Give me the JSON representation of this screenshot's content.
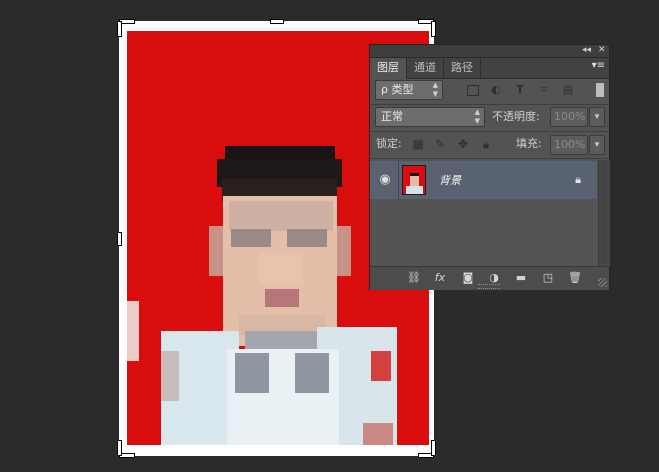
{
  "panel": {
    "tabs": [
      {
        "label": "图层",
        "active": true
      },
      {
        "label": "通道",
        "active": false
      },
      {
        "label": "路径",
        "active": false
      }
    ],
    "collapse_glyph": "◂◂",
    "close_glyph": "✕",
    "menu_glyph": "▾≡",
    "filter": {
      "kind_label": "ρ 类型",
      "icons": [
        "image-filter-icon",
        "adjustment-filter-icon",
        "type-filter-icon",
        "shape-filter-icon",
        "smart-object-filter-icon"
      ]
    },
    "blend_mode": "正常",
    "opacity_label": "不透明度:",
    "opacity_value": "100%",
    "lock_label": "锁定:",
    "fill_label": "填充:",
    "fill_value": "100%",
    "layers": [
      {
        "name": "背景",
        "visible": true,
        "locked": true,
        "selected": true
      }
    ],
    "bottom_icons": [
      "link-layers-icon",
      "fx-icon",
      "add-mask-icon",
      "adjustment-layer-icon",
      "new-group-icon",
      "new-layer-icon",
      "delete-layer-icon"
    ]
  },
  "colors": {
    "background_red": "#d90d0d",
    "panel_bg": "#535353",
    "selected_row": "#596270"
  }
}
